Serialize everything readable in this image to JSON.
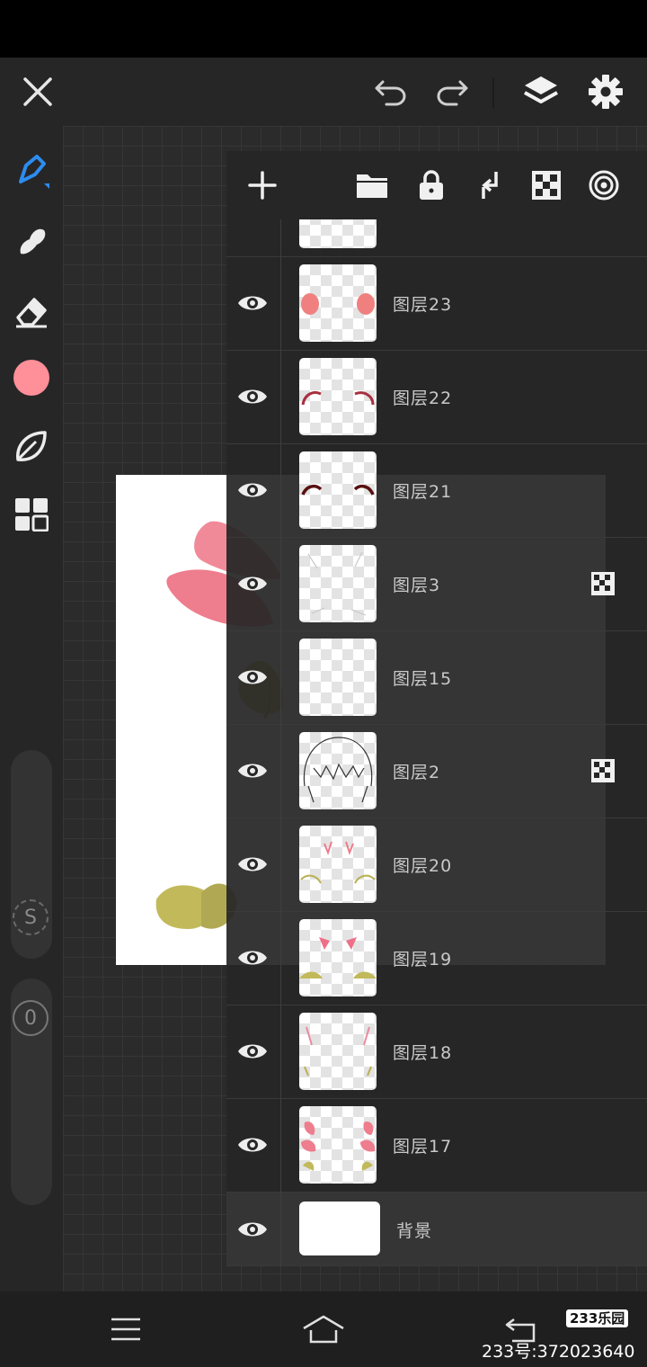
{
  "toolbar": {
    "close_icon": "close-icon",
    "undo_icon": "undo-icon",
    "redo_icon": "redo-icon",
    "layers_icon": "layers-icon",
    "settings_icon": "gear-icon"
  },
  "tools": {
    "brush": "brush-icon",
    "smudge": "smudge-icon",
    "eraser": "eraser-icon",
    "color": "#ff8f98",
    "leaf": "leaf-icon",
    "grid": "grid-icon",
    "accent": "#2d8cf0"
  },
  "sliders": {
    "size_label": "S",
    "opacity_label": "0"
  },
  "layer_toolbar": [
    "add-layer-icon",
    "folder-icon",
    "lock-icon",
    "merge-down-icon",
    "checker-icon",
    "target-icon"
  ],
  "layers": [
    {
      "name": "图层23",
      "badge": false
    },
    {
      "name": "图层22",
      "badge": false
    },
    {
      "name": "图层21",
      "badge": false
    },
    {
      "name": "图层3",
      "badge": true
    },
    {
      "name": "图层15",
      "badge": false
    },
    {
      "name": "图层2",
      "badge": true
    },
    {
      "name": "图层20",
      "badge": false
    },
    {
      "name": "图层19",
      "badge": false
    },
    {
      "name": "图层18",
      "badge": false
    },
    {
      "name": "图层17",
      "badge": false
    },
    {
      "name": "背景",
      "badge": false
    }
  ],
  "navigation": {
    "menu_icon": "menu-icon",
    "home_icon": "home-icon",
    "back_icon": "back-icon"
  },
  "watermark": {
    "logo": "233乐园",
    "text": "233号:372023640"
  }
}
